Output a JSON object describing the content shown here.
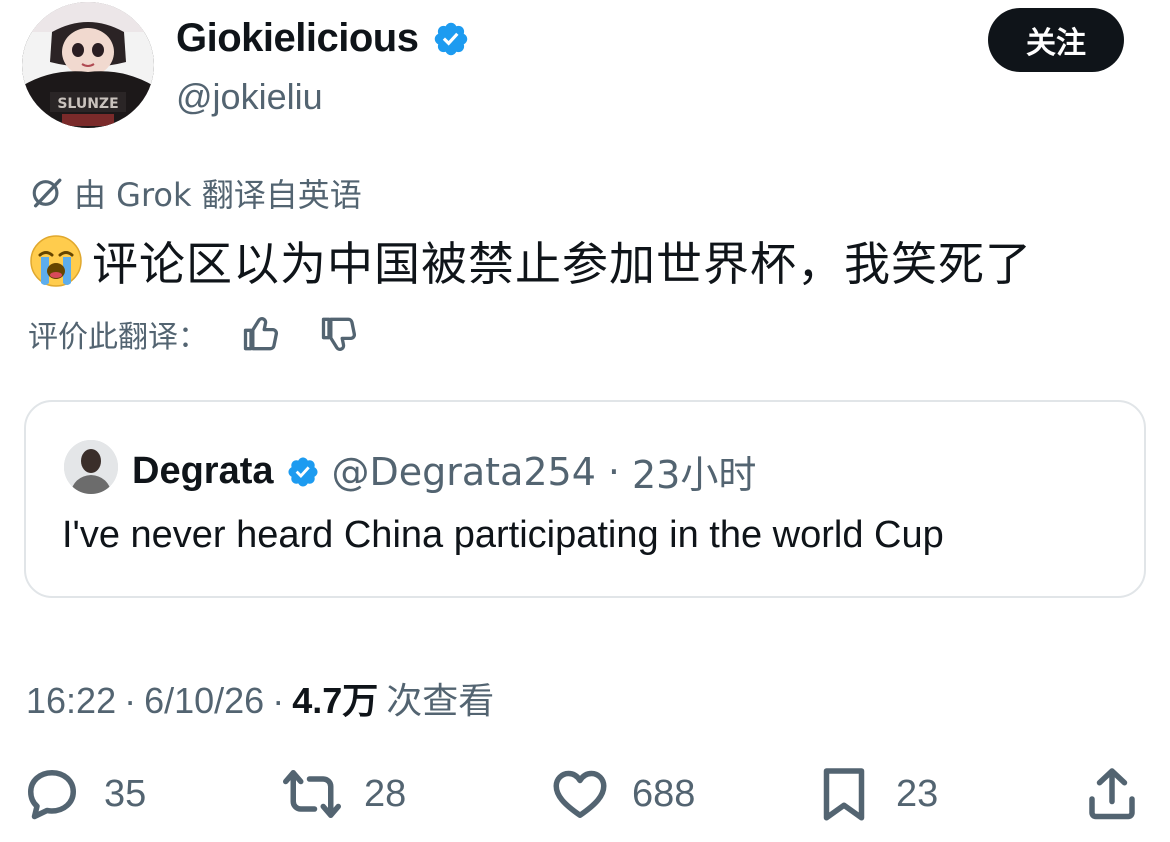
{
  "author": {
    "display_name": "Giokielicious",
    "handle": "@jokieliu",
    "verified": true,
    "avatar_shirt_text": "SLUNZE"
  },
  "follow_button": "关注",
  "translation": {
    "label": "由 Grok 翻译自英语",
    "icon": "grok-icon"
  },
  "tweet": {
    "emoji": "loudly-crying-face",
    "text": "评论区以为中国被禁止参加世界杯，我笑死了"
  },
  "rate_translation": {
    "label": "评价此翻译：",
    "thumbs_up": "thumbs-up-icon",
    "thumbs_down": "thumbs-down-icon"
  },
  "quoted_tweet": {
    "name": "Degrata",
    "verified": true,
    "handle": "@Degrata254",
    "separator": "·",
    "time": "23小时",
    "text": "I've never heard China participating in the world Cup"
  },
  "meta": {
    "time": "16:22",
    "sep1": "·",
    "date": "6/10/26",
    "sep2": "·",
    "views": "4.7万",
    "views_label": "次查看"
  },
  "actions": {
    "replies": "35",
    "reposts": "28",
    "likes": "688",
    "bookmarks": "23"
  },
  "colors": {
    "text": "#0f1419",
    "secondary": "#536471",
    "verified": "#1d9bf0",
    "border": "#e1e5e8",
    "button_bg": "#0f1419"
  }
}
